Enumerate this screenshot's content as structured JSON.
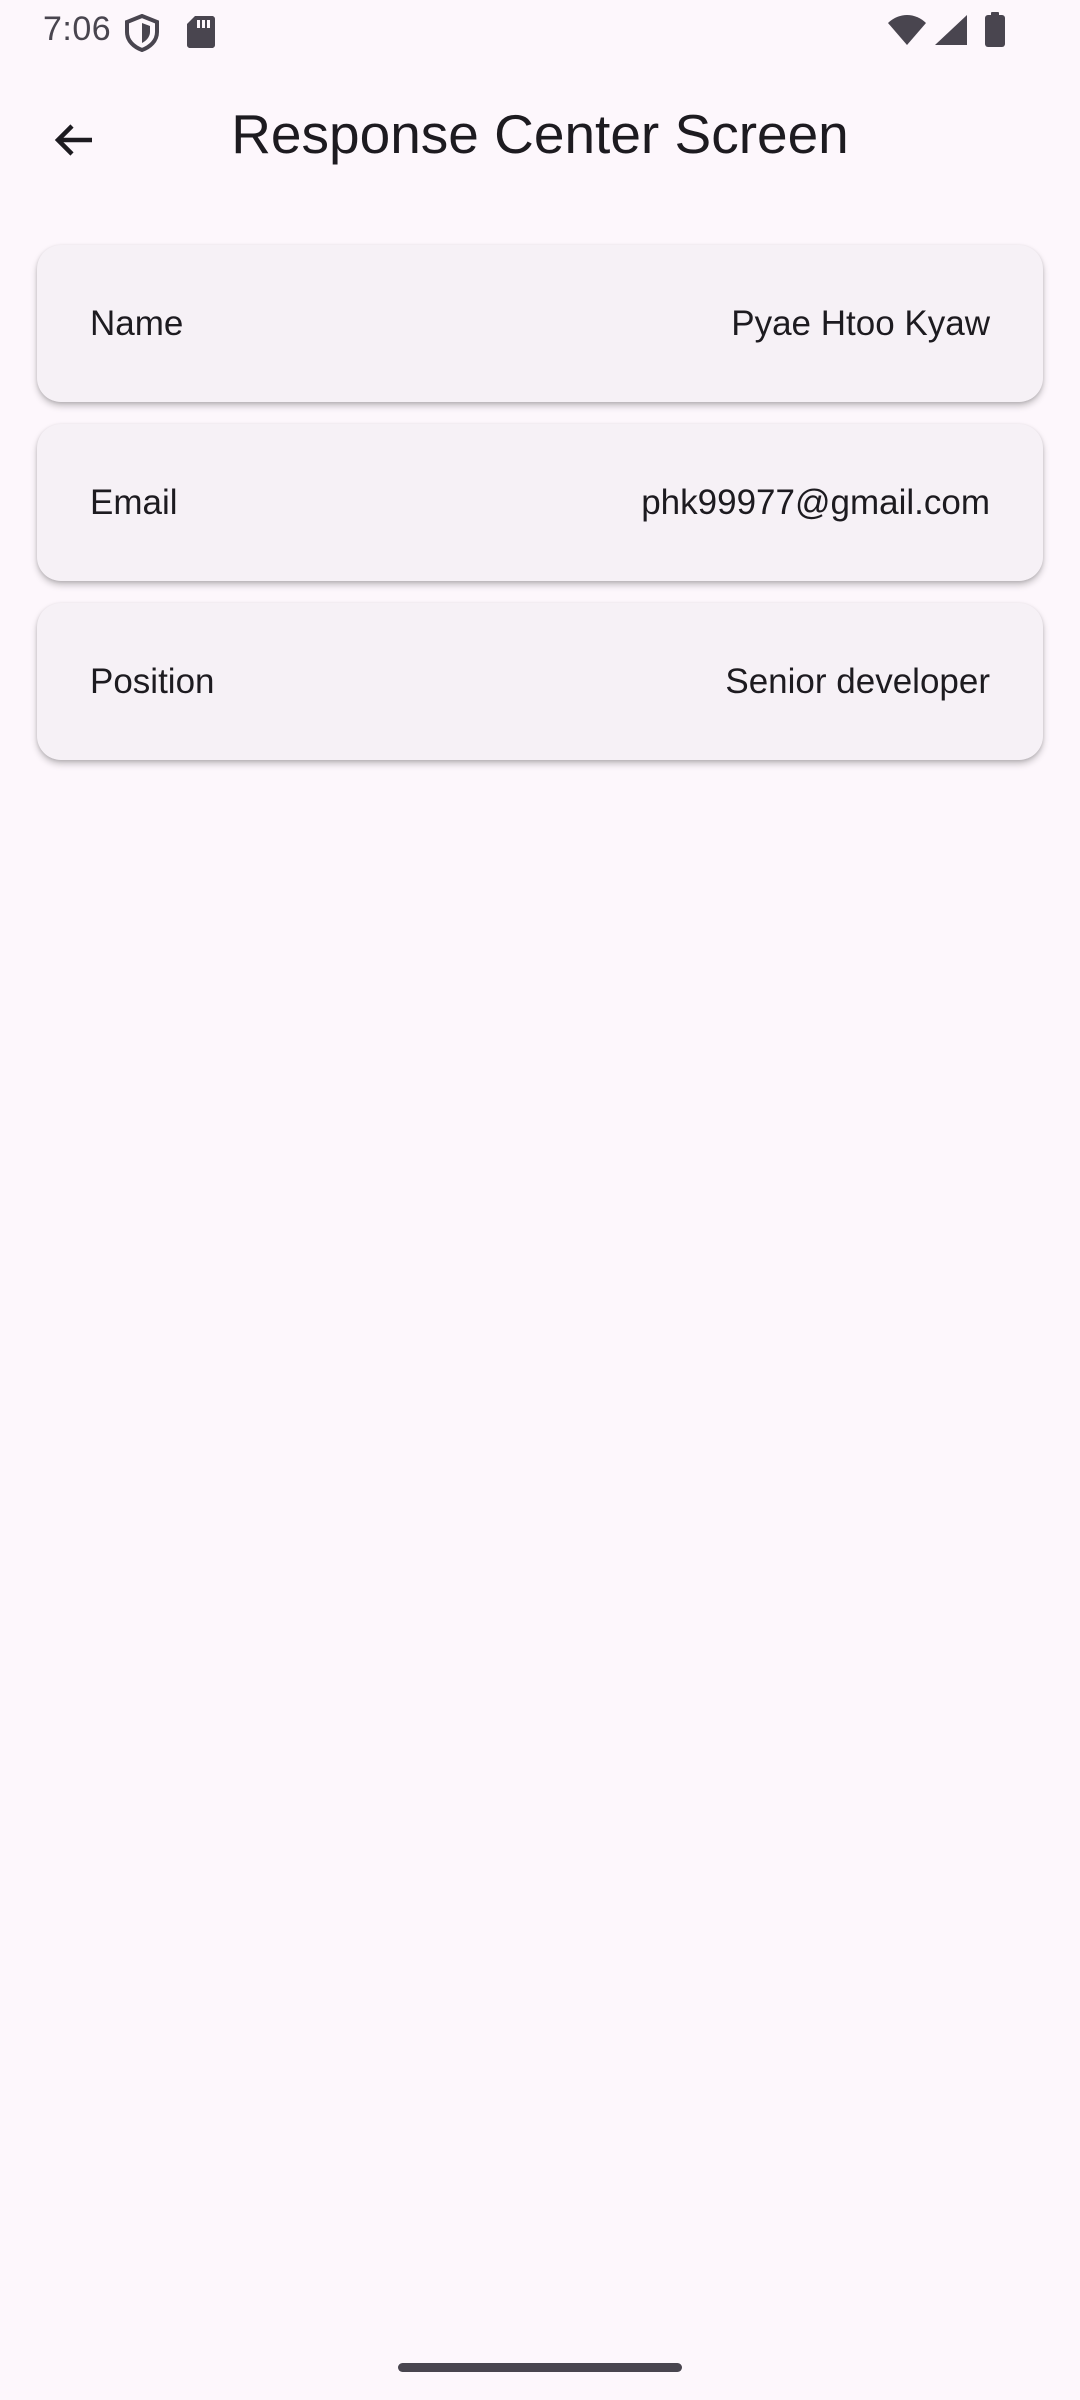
{
  "status_bar": {
    "time": "7:06",
    "icons": [
      "shield-icon",
      "sd-card-icon",
      "wifi-icon",
      "cellular-signal-icon",
      "battery-icon"
    ]
  },
  "app_bar": {
    "back_icon": "arrow-back-icon",
    "title": "Response Center Screen"
  },
  "details": [
    {
      "label": "Name",
      "value": "Pyae Htoo Kyaw"
    },
    {
      "label": "Email",
      "value": "phk99977@gmail.com"
    },
    {
      "label": "Position",
      "value": "Senior developer"
    }
  ],
  "colors": {
    "background": "#FDF7FC",
    "card": "#F6F1F6",
    "text": "#1D1B20",
    "status_icon": "#49454F"
  }
}
